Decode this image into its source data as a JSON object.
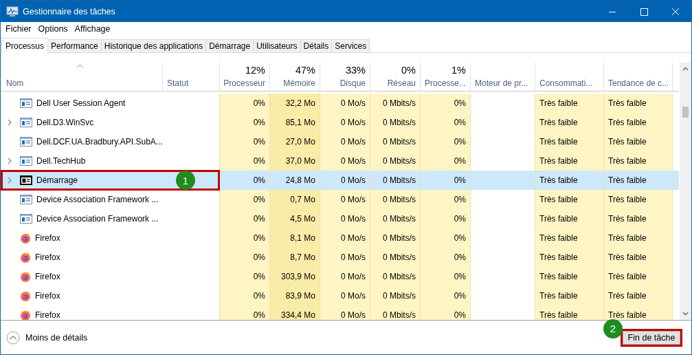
{
  "window": {
    "title": "Gestionnaire des tâches"
  },
  "menu": [
    "Fichier",
    "Options",
    "Affichage"
  ],
  "tabs": [
    {
      "label": "Processus",
      "selected": true
    },
    {
      "label": "Performance",
      "selected": false
    },
    {
      "label": "Historique des applications",
      "selected": false
    },
    {
      "label": "Démarrage",
      "selected": false
    },
    {
      "label": "Utilisateurs",
      "selected": false
    },
    {
      "label": "Détails",
      "selected": false
    },
    {
      "label": "Services",
      "selected": false
    }
  ],
  "table": {
    "columns": [
      {
        "label": "Nom",
        "kind": "name",
        "sorted": true
      },
      {
        "label": "Statut",
        "kind": "blank"
      },
      {
        "label": "Processeur",
        "total": "12%",
        "kind": "metric",
        "color": "#fff4c4"
      },
      {
        "label": "Mémoire",
        "total": "47%",
        "kind": "metric",
        "color": "#f9eca8"
      },
      {
        "label": "Disque",
        "total": "33%",
        "kind": "metric",
        "color": "#fff4c4"
      },
      {
        "label": "Réseau",
        "total": "0%",
        "kind": "metric",
        "color": "#fff4c4"
      },
      {
        "label": "Processe...",
        "total": "1%",
        "kind": "metric",
        "color": "#fff4c4"
      },
      {
        "label": "Moteur de pr...",
        "kind": "blank"
      },
      {
        "label": "Consommati...",
        "kind": "text",
        "color": "#fff4c4"
      },
      {
        "label": "Tendance de c...",
        "kind": "text",
        "color": "#fff4c4"
      }
    ],
    "rows": [
      {
        "kind": "app",
        "expandable": false,
        "selected": false,
        "cells": [
          "Dell User Session Agent",
          "",
          "0%",
          "32,2 Mo",
          "0 Mo/s",
          "0 Mbits/s",
          "0%",
          "",
          "Très faible",
          "Très faible"
        ]
      },
      {
        "kind": "app",
        "expandable": true,
        "selected": false,
        "cells": [
          "Dell.D3.WinSvc",
          "",
          "0%",
          "85,1 Mo",
          "0 Mo/s",
          "0 Mbits/s",
          "0%",
          "",
          "Très faible",
          "Très faible"
        ]
      },
      {
        "kind": "app",
        "expandable": false,
        "selected": false,
        "cells": [
          "Dell.DCF.UA.Bradbury.API.SubA...",
          "",
          "0%",
          "27,0 Mo",
          "0 Mo/s",
          "0 Mbits/s",
          "0%",
          "",
          "Très faible",
          "Très faible"
        ]
      },
      {
        "kind": "app",
        "expandable": true,
        "selected": false,
        "cells": [
          "Dell.TechHub",
          "",
          "0%",
          "37,0 Mo",
          "0 Mo/s",
          "0 Mbits/s",
          "0%",
          "",
          "Très faible",
          "Très faible"
        ]
      },
      {
        "kind": "app-dark",
        "expandable": true,
        "selected": true,
        "callout": "1",
        "cells": [
          "Démarrage",
          "",
          "0%",
          "24,8 Mo",
          "0 Mo/s",
          "0 Mbits/s",
          "0%",
          "",
          "Très faible",
          "Très faible"
        ]
      },
      {
        "kind": "app",
        "expandable": false,
        "selected": false,
        "cells": [
          "Device Association Framework ...",
          "",
          "0%",
          "0,7 Mo",
          "0 Mo/s",
          "0 Mbits/s",
          "0%",
          "",
          "Très faible",
          "Très faible"
        ]
      },
      {
        "kind": "app",
        "expandable": false,
        "selected": false,
        "cells": [
          "Device Association Framework ...",
          "",
          "0%",
          "4,5 Mo",
          "0 Mo/s",
          "0 Mbits/s",
          "0%",
          "",
          "Très faible",
          "Très faible"
        ]
      },
      {
        "kind": "firefox",
        "expandable": false,
        "selected": false,
        "cells": [
          "Firefox",
          "",
          "0%",
          "8,1 Mo",
          "0 Mo/s",
          "0 Mbits/s",
          "0%",
          "",
          "Très faible",
          "Très faible"
        ]
      },
      {
        "kind": "firefox",
        "expandable": false,
        "selected": false,
        "cells": [
          "Firefox",
          "",
          "0%",
          "8,7 Mo",
          "0 Mo/s",
          "0 Mbits/s",
          "0%",
          "",
          "Très faible",
          "Très faible"
        ]
      },
      {
        "kind": "firefox",
        "expandable": false,
        "selected": false,
        "cells": [
          "Firefox",
          "",
          "0%",
          "303,9 Mo",
          "0 Mo/s",
          "0 Mbits/s",
          "0%",
          "",
          "Très faible",
          "Très faible"
        ]
      },
      {
        "kind": "firefox",
        "expandable": false,
        "selected": false,
        "cells": [
          "Firefox",
          "",
          "0%",
          "83,9 Mo",
          "0 Mo/s",
          "0 Mbits/s",
          "0%",
          "",
          "Très faible",
          "Très faible"
        ]
      },
      {
        "kind": "firefox",
        "expandable": false,
        "selected": false,
        "cells": [
          "Firefox",
          "",
          "0%",
          "334,4 Mo",
          "0 Mo/s",
          "0 Mbits/s",
          "0%",
          "",
          "Très faible",
          "Très faible"
        ]
      }
    ]
  },
  "footer": {
    "details_toggle": "Moins de détails",
    "end_task": {
      "label": "Fin de tâche",
      "callout": "2"
    }
  }
}
